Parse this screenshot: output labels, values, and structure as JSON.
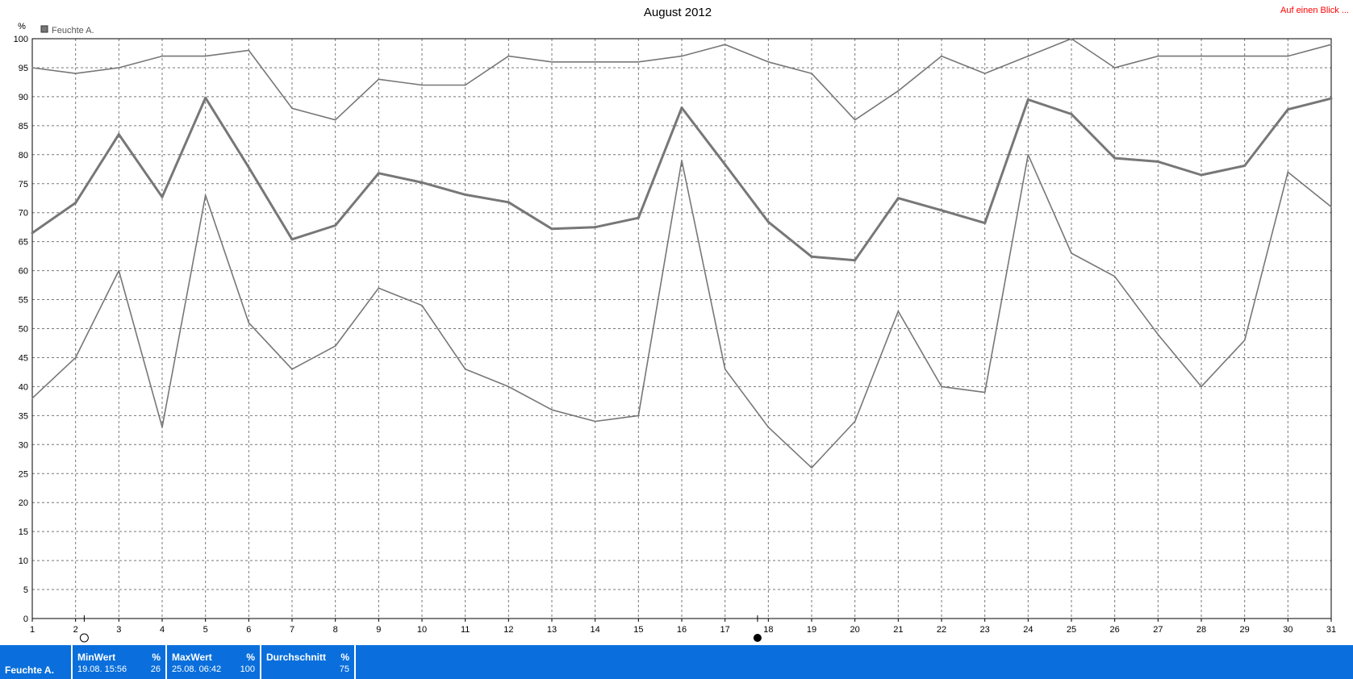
{
  "chart_data": {
    "type": "line",
    "title": "August 2012",
    "y_unit_label": "%",
    "link_label": "Auf einen Blick ...",
    "legend": {
      "label": "Feuchte A.",
      "color": "#777777"
    },
    "x": [
      1,
      2,
      3,
      4,
      5,
      6,
      7,
      8,
      9,
      10,
      11,
      12,
      13,
      14,
      15,
      16,
      17,
      18,
      19,
      20,
      21,
      22,
      23,
      24,
      25,
      26,
      27,
      28,
      29,
      30,
      31
    ],
    "x_ticks": [
      "1",
      "2",
      "3",
      "4",
      "5",
      "6",
      "7",
      "8",
      "9",
      "10",
      "11",
      "12",
      "13",
      "14",
      "15",
      "16",
      "17",
      "18",
      "19",
      "20",
      "21",
      "22",
      "23",
      "24",
      "25",
      "26",
      "27",
      "28",
      "29",
      "30",
      "31"
    ],
    "y_ticks": [
      "0",
      "5",
      "10",
      "15",
      "20",
      "25",
      "30",
      "35",
      "40",
      "45",
      "50",
      "55",
      "60",
      "65",
      "70",
      "75",
      "80",
      "85",
      "90",
      "95",
      "100"
    ],
    "ylim": [
      0,
      100
    ],
    "xlim": [
      1,
      31
    ],
    "grid": true,
    "series": [
      {
        "key": "max",
        "values": [
          95,
          94,
          95,
          97,
          97,
          98,
          88,
          86,
          93,
          92,
          92,
          97,
          96,
          96,
          96,
          97,
          99,
          96,
          94,
          86,
          91,
          97,
          94,
          97,
          100,
          95,
          97,
          97,
          97,
          97,
          99
        ],
        "color": "#777777",
        "width": 1.6
      },
      {
        "key": "avg",
        "values": [
          66.5,
          71.7,
          83.5,
          72.7,
          89.8,
          77.8,
          65.4,
          67.8,
          76.8,
          75.2,
          73.1,
          71.8,
          67.2,
          67.5,
          69.1,
          88.1,
          78.3,
          68.4,
          62.4,
          61.8,
          72.5,
          70.4,
          68.2,
          89.5,
          87.0,
          79.4,
          78.8,
          76.5,
          78.1,
          87.8,
          89.7
        ],
        "color": "#777777",
        "width": 3
      },
      {
        "key": "min",
        "values": [
          38,
          45,
          60,
          33,
          73,
          51,
          43,
          47,
          57,
          54,
          43,
          40,
          36,
          34,
          35,
          79,
          43,
          33,
          26,
          34,
          53,
          40,
          39,
          80,
          63,
          59,
          49,
          40,
          48,
          77,
          71
        ],
        "color": "#777777",
        "width": 1.6
      }
    ],
    "markers": [
      {
        "x": 2.2,
        "kind": "open-circle"
      },
      {
        "x": 17.75,
        "kind": "filled-circle"
      }
    ]
  },
  "stats": {
    "row_label": "Feuchte A.",
    "columns": [
      {
        "header": "MinWert",
        "unit": "%",
        "time": "19.08.  15:56",
        "value": "26"
      },
      {
        "header": "MaxWert",
        "unit": "%",
        "time": "25.08.  06:42",
        "value": "100"
      },
      {
        "header": "Durchschnitt",
        "unit": "%",
        "time": "",
        "value": "75"
      }
    ]
  }
}
